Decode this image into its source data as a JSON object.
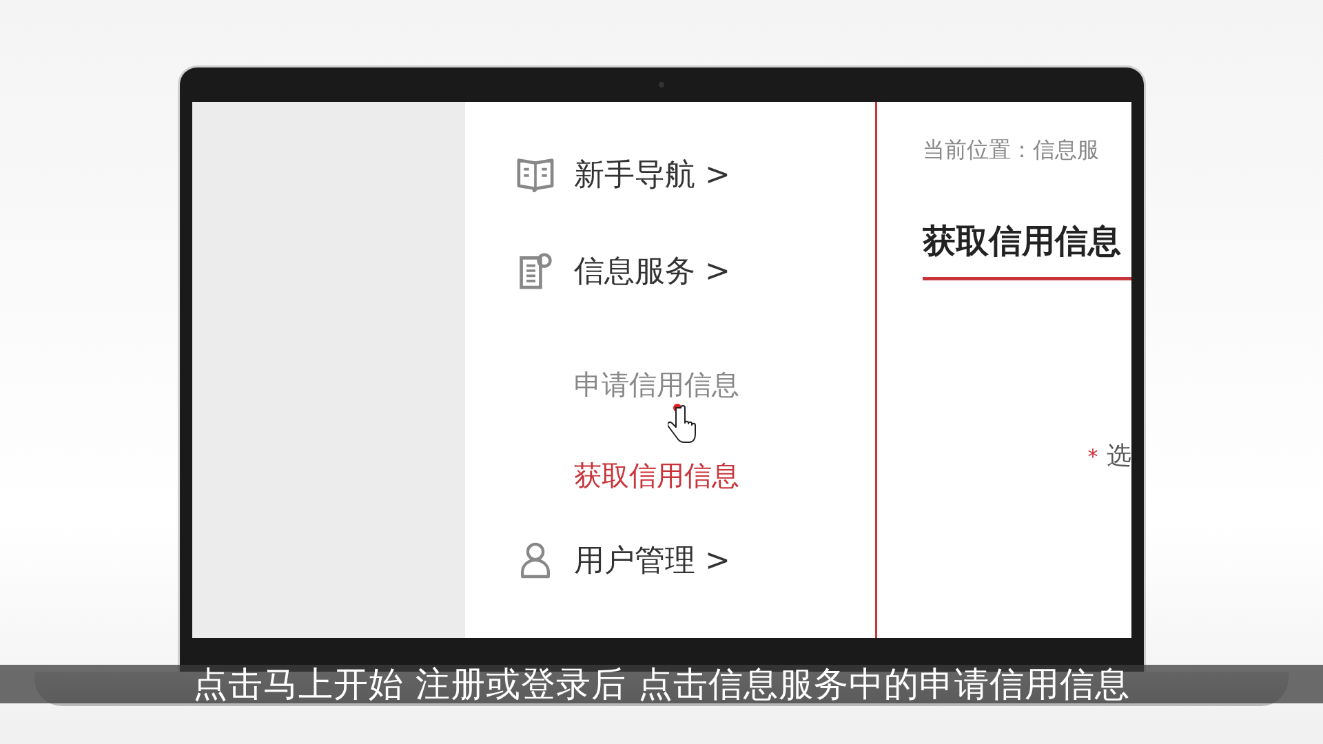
{
  "sidebar": {
    "items": [
      {
        "label": "新手导航",
        "arrow": ">"
      },
      {
        "label": "信息服务",
        "arrow": ">",
        "children": [
          {
            "label": "申请信用信息",
            "selected": false
          },
          {
            "label": "获取信用信息",
            "selected": true
          }
        ]
      },
      {
        "label": "用户管理",
        "arrow": ">"
      }
    ]
  },
  "content": {
    "breadcrumb": "当前位置：信息服",
    "title": "获取信用信息",
    "field": {
      "required_mark": "*",
      "label": "选"
    }
  },
  "caption": "点击马上开始 注册或登录后 点击信息服务中的申请信用信息"
}
